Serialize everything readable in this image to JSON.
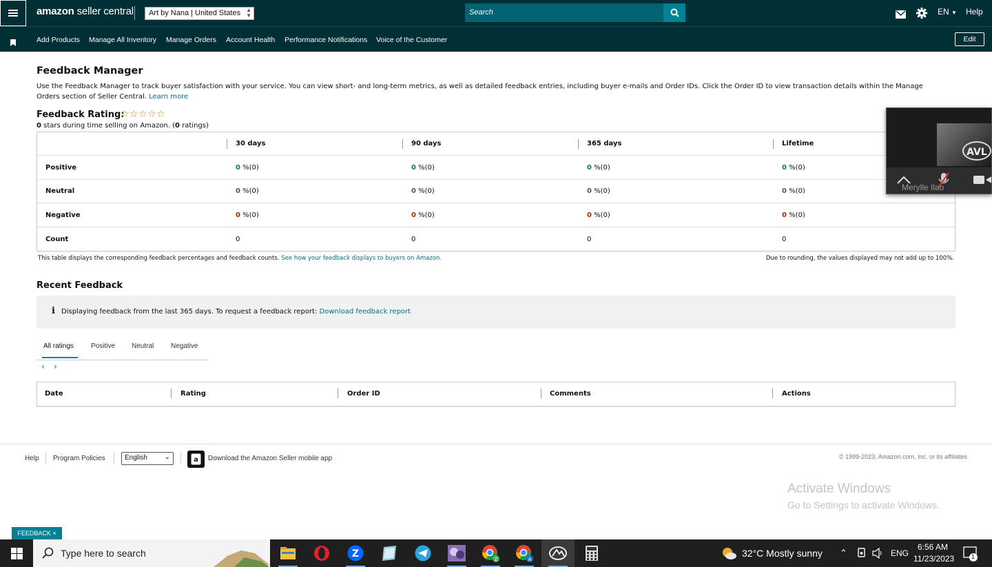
{
  "header": {
    "logo_brand": "amazon",
    "logo_product": "seller central",
    "store": "Art by Nana | United States",
    "search_placeholder": "Search",
    "lang": "EN",
    "help": "Help"
  },
  "nav": {
    "items": [
      "Add Products",
      "Manage All Inventory",
      "Manage Orders",
      "Account Health",
      "Performance Notifications",
      "Voice of the Customer"
    ],
    "edit": "Edit"
  },
  "page": {
    "title": "Feedback Manager",
    "intro": "Use the Feedback Manager to track buyer satisfaction with your service. You can view short- and long-term metrics, as well as detailed feedback entries, including buyer e-mails and Order IDs. Click the Order ID to view transaction details within the Manage Orders section of Seller Central.",
    "learn_more": "Learn more",
    "rating_title": "Feedback Rating:",
    "stars": "☆☆☆☆☆",
    "rating_stars_value": "0",
    "rating_sub_mid": " stars during time selling on Amazon. (",
    "rating_count_value": "0",
    "rating_sub_end": " ratings)"
  },
  "feedback_table": {
    "columns": [
      "30 days",
      "90 days",
      "365 days",
      "Lifetime"
    ],
    "rows": [
      {
        "label": "Positive",
        "values": [
          "0",
          "0",
          "0",
          "0"
        ],
        "suffix": " %(0)"
      },
      {
        "label": "Neutral",
        "values": [
          "0",
          "0",
          "0",
          "0"
        ],
        "suffix": " %(0)"
      },
      {
        "label": "Negative",
        "values": [
          "0",
          "0",
          "0",
          "0"
        ],
        "suffix": " %(0)"
      },
      {
        "label": "Count",
        "values": [
          "0",
          "0",
          "0",
          "0"
        ],
        "suffix": ""
      }
    ],
    "note_left": "This table displays the corresponding feedback percentages and feedback counts.",
    "note_left_link": "See how your feedback displays to buyers on Amazon.",
    "note_right": "Due to rounding, the values displayed may not add up to 100%."
  },
  "recent": {
    "title": "Recent Feedback",
    "info": "Displaying feedback from the last 365 days. To request a feedback report:",
    "info_link": "Download feedback report",
    "tabs": [
      "All ratings",
      "Positive",
      "Neutral",
      "Negative"
    ],
    "prev": "‹",
    "next": "›",
    "columns": [
      "Date",
      "Rating",
      "Order ID",
      "Comments",
      "Actions"
    ]
  },
  "footer": {
    "help": "Help",
    "policies": "Program Policies",
    "language": "English",
    "app_text": "Download the Amazon Seller mobile app",
    "copyright": "© 1999-2023, Amazon.com, Inc. or its affiliates"
  },
  "windows": {
    "activate_title": "Activate Windows",
    "activate_sub": "Go to Settings to activate Windows."
  },
  "feedback_button": "FEEDBACK ×",
  "video": {
    "name": "Merylle Ilao"
  },
  "taskbar": {
    "search": "Type here to search",
    "weather": "32°C  Mostly sunny",
    "lang": "ENG",
    "time": "6:56 AM",
    "date": "11/23/2023",
    "notif_count": "1"
  },
  "colors": {
    "topbar": "#002f36",
    "accent": "#008296",
    "positive": "#067d62",
    "negative": "#b12704"
  }
}
